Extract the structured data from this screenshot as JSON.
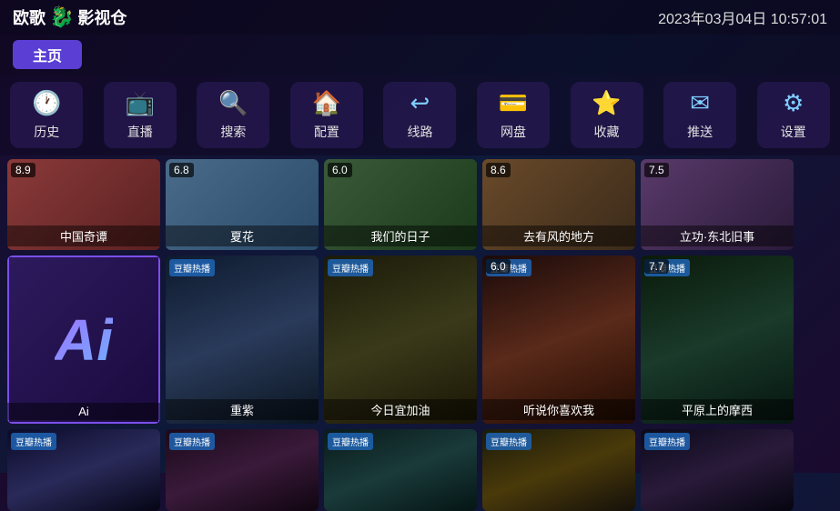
{
  "header": {
    "logo_text": "欧歌",
    "logo_suffix": "影视仓",
    "datetime": "2023年03月04日 10:57:01"
  },
  "home_button": {
    "label": "主页"
  },
  "nav": {
    "items": [
      {
        "id": "history",
        "icon": "🕐",
        "label": "历史"
      },
      {
        "id": "live",
        "icon": "📺",
        "label": "直播"
      },
      {
        "id": "search",
        "icon": "🔍",
        "label": "搜索"
      },
      {
        "id": "config",
        "icon": "🏠",
        "label": "配置"
      },
      {
        "id": "route",
        "icon": "↩",
        "label": "线路"
      },
      {
        "id": "netdisk",
        "icon": "💳",
        "label": "网盘"
      },
      {
        "id": "favorites",
        "icon": "⭐",
        "label": "收藏"
      },
      {
        "id": "push",
        "icon": "✉",
        "label": "推送"
      },
      {
        "id": "settings",
        "icon": "⚙",
        "label": "设置"
      }
    ]
  },
  "top_row": [
    {
      "id": "zhongguoqitan",
      "score": "8.9",
      "title": "中国奇谭",
      "color": "c1"
    },
    {
      "id": "xiahua",
      "score": "6.8",
      "title": "夏花",
      "color": "c2"
    },
    {
      "id": "womenderizi",
      "score": "6.0",
      "title": "我们的日子",
      "color": "c3"
    },
    {
      "id": "quyoufengdedifang",
      "score": "8.6",
      "title": "去有风的地方",
      "color": "c4"
    },
    {
      "id": "lifudongbeijushi",
      "score": "7.5",
      "title": "立功·东北旧事",
      "color": "c5"
    }
  ],
  "mid_row": [
    {
      "id": "ai",
      "badge": "",
      "title": "Ai",
      "color": "ai-card",
      "score": ""
    },
    {
      "id": "chongzi",
      "badge": "豆瓣热播",
      "title": "重紫",
      "color": "p2",
      "score": ""
    },
    {
      "id": "jinyiyijiayou",
      "badge": "豆瓣热播",
      "title": "今日宜加油",
      "color": "p3",
      "score": ""
    },
    {
      "id": "tingshuonixihuanwo",
      "badge": "豆瓣热播",
      "title": "听说你喜欢我",
      "color": "p4",
      "score": "6.0"
    },
    {
      "id": "pingyuanshangdemoxie",
      "badge": "豆瓣热播",
      "title": "平原上的摩西",
      "color": "p5",
      "score": "7.7"
    }
  ],
  "bot_row": [
    {
      "id": "bot1",
      "badge": "豆瓣热播",
      "title": "",
      "color": "p6"
    },
    {
      "id": "bot2",
      "badge": "豆瓣热播",
      "title": "",
      "color": "p7"
    },
    {
      "id": "bot3",
      "badge": "豆瓣热播",
      "title": "",
      "color": "p8"
    },
    {
      "id": "bot4",
      "badge": "豆瓣热播",
      "title": "",
      "color": "p9"
    },
    {
      "id": "bot5",
      "badge": "豆瓣热播",
      "title": "",
      "color": "p10"
    }
  ],
  "badges": {
    "doupiao": "豆瓣热播"
  }
}
